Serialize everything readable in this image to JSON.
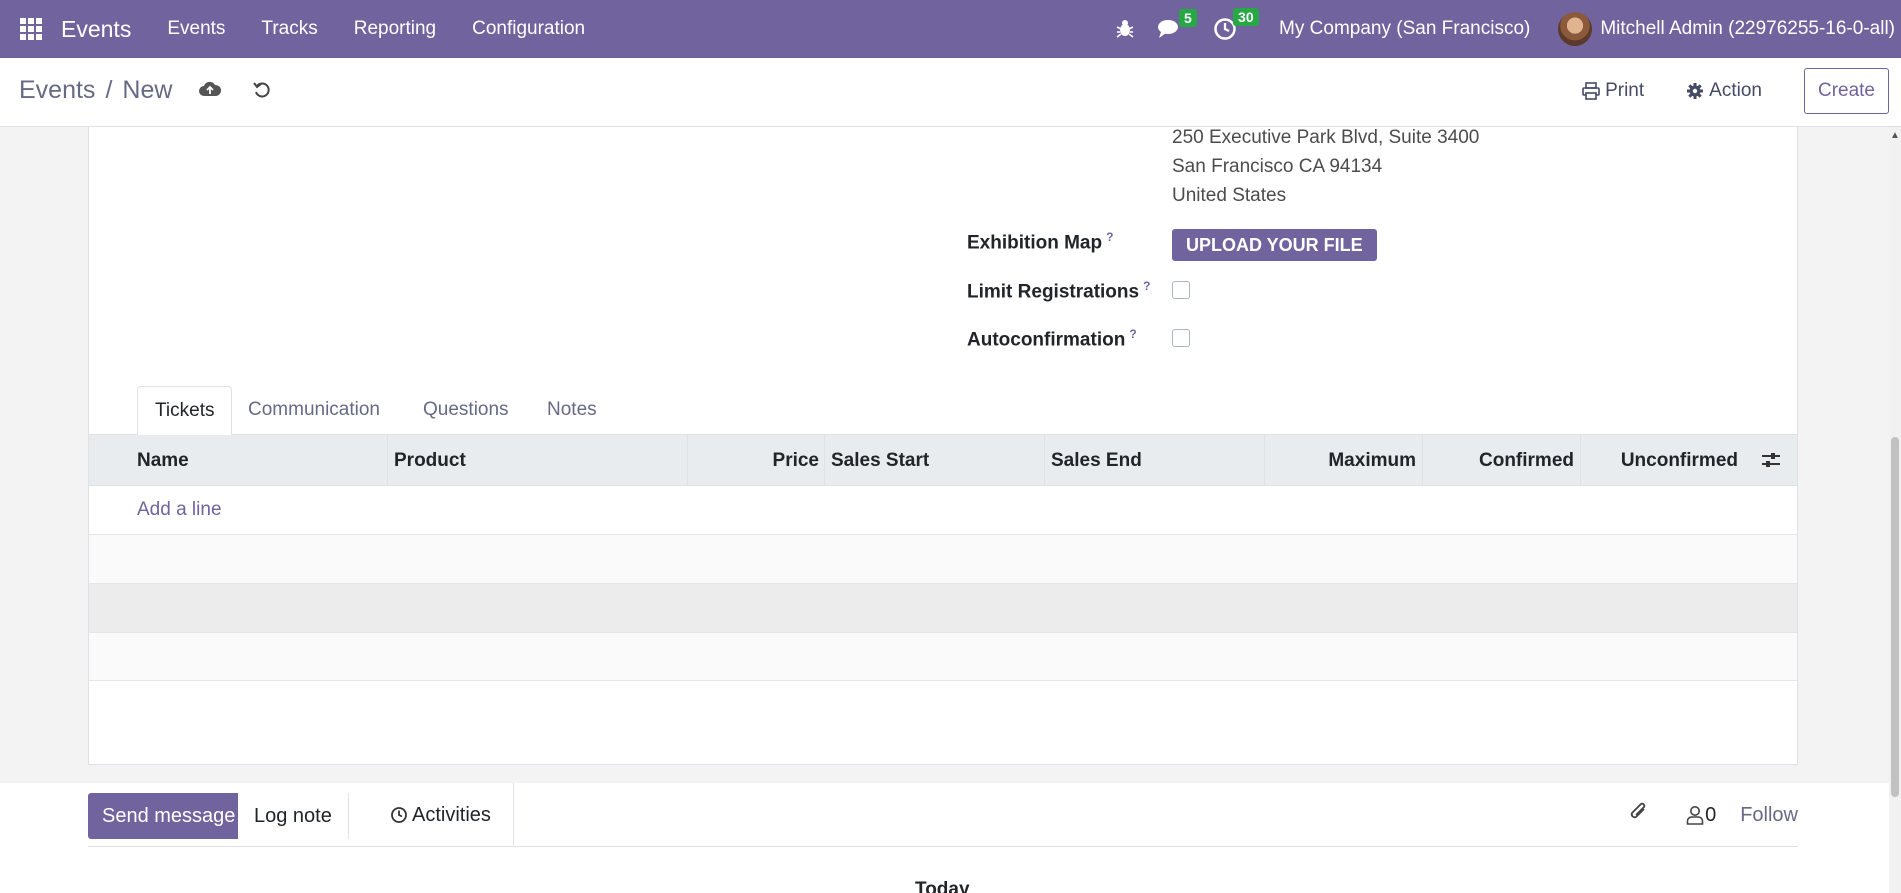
{
  "navbar": {
    "app_name": "Events",
    "menus": [
      "Events",
      "Tracks",
      "Reporting",
      "Configuration"
    ],
    "messages_count": "5",
    "activities_count": "30",
    "company": "My Company (San Francisco)",
    "user": "Mitchell Admin (22976255-16-0-all)"
  },
  "control_panel": {
    "breadcrumb_parent": "Events",
    "breadcrumb_separator": "/",
    "breadcrumb_current": "New",
    "print_label": "Print",
    "action_label": "Action",
    "create_label": "Create"
  },
  "form": {
    "address_lines": [
      "250 Executive Park Blvd, Suite 3400",
      "San Francisco CA 94134",
      "United States"
    ],
    "exhibition_map_label": "Exhibition Map",
    "upload_label": "UPLOAD YOUR FILE",
    "limit_registrations_label": "Limit Registrations",
    "autoconfirmation_label": "Autoconfirmation",
    "help_mark": "?"
  },
  "tabs": [
    "Tickets",
    "Communication",
    "Questions",
    "Notes"
  ],
  "table": {
    "columns": [
      "Name",
      "Product",
      "Price",
      "Sales Start",
      "Sales End",
      "Maximum",
      "Confirmed",
      "Unconfirmed"
    ],
    "add_line": "Add a line"
  },
  "chatter": {
    "send_message": "Send message",
    "log_note": "Log note",
    "activities": "Activities",
    "followers_count": "0",
    "follow": "Follow",
    "today": "Today"
  }
}
